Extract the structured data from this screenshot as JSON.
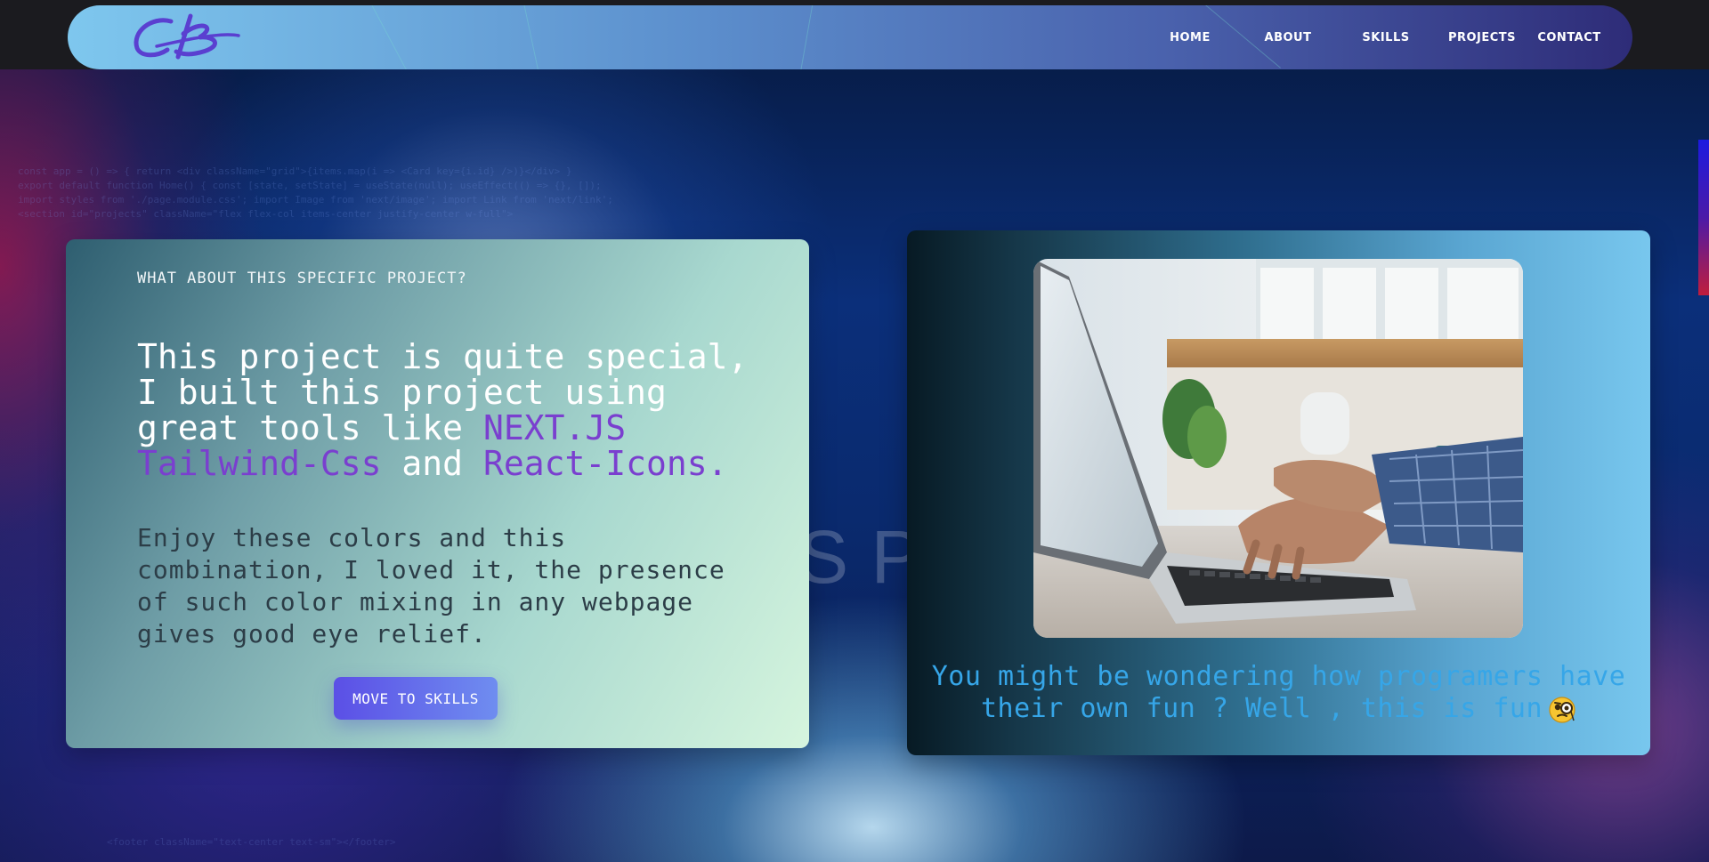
{
  "navbar": {
    "logo_text": "CB",
    "links": [
      "HOME",
      "ABOUT",
      "SKILLS",
      "PROJECTS",
      "CONTACT"
    ]
  },
  "background": {
    "watermark": "<H>CODE IS POETRY</H>"
  },
  "project_card": {
    "eyebrow": "WHAT ABOUT THIS SPECIFIC PROJECT?",
    "headline_prefix": "This project is quite special, I built this project using great tools like ",
    "highlight_tools": "NEXT.JS Tailwind-Css",
    "headline_and": " and ",
    "highlight_icons": "React-Icons.",
    "body": "Enjoy these colors and this combination, I loved it, the presence of such color mixing in any webpage gives good eye relief.",
    "button_label": "MOVE TO SKILLS"
  },
  "image_card": {
    "caption": "You might be wondering how programers have their own fun ? Well , this is fun",
    "emoji_icon": "monocle-face-icon"
  },
  "colors": {
    "accent_purple": "#7a3fcf",
    "caption_blue": "#36a6e8",
    "button_start": "#5b4fe6",
    "button_end": "#6f8df0"
  }
}
